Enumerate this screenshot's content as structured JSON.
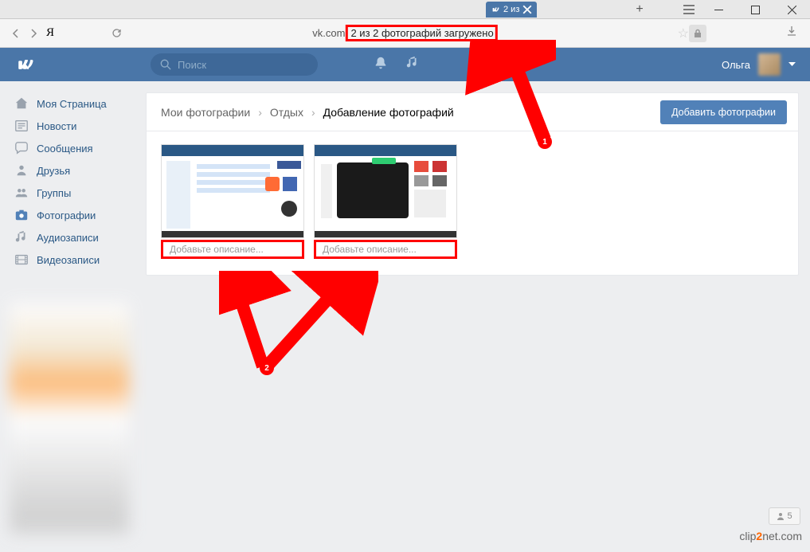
{
  "window": {
    "tab_title": "2 из",
    "buttons": {
      "minimize": "",
      "maximize": "",
      "close": ""
    }
  },
  "address_bar": {
    "domain": "vk.com",
    "title": "2 из 2 фотографий загружено"
  },
  "header": {
    "search_placeholder": "Поиск",
    "username": "Ольга"
  },
  "sidebar": {
    "items": [
      {
        "label": "Моя Страница"
      },
      {
        "label": "Новости"
      },
      {
        "label": "Сообщения"
      },
      {
        "label": "Друзья"
      },
      {
        "label": "Группы"
      },
      {
        "label": "Фотографии"
      },
      {
        "label": "Аудиозаписи"
      },
      {
        "label": "Видеозаписи"
      }
    ]
  },
  "content": {
    "breadcrumbs": {
      "root": "Мои фотографии",
      "album": "Отдых",
      "current": "Добавление фотографий"
    },
    "add_button": "Добавить фотографии",
    "photos": [
      {
        "desc_placeholder": "Добавьте описание..."
      },
      {
        "desc_placeholder": "Добавьте описание..."
      }
    ]
  },
  "annotations": {
    "marker1": "1",
    "marker2": "2"
  },
  "footer": {
    "share_count": "5",
    "watermark_pre": "clip",
    "watermark_mid": "2",
    "watermark_post": "net.com"
  }
}
